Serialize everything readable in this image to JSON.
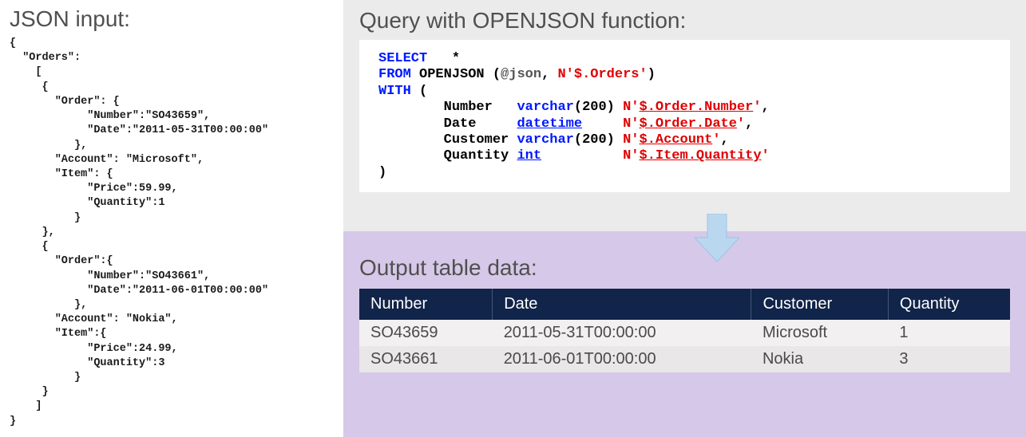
{
  "left": {
    "title": "JSON input:",
    "json_text": "{\n  \"Orders\":\n    [\n     {\n       \"Order\": {\n            \"Number\":\"SO43659\",\n            \"Date\":\"2011-05-31T00:00:00\"\n          },\n       \"Account\": \"Microsoft\",\n       \"Item\": {\n            \"Price\":59.99,\n            \"Quantity\":1\n          }\n     },\n     {\n       \"Order\":{\n            \"Number\":\"SO43661\",\n            \"Date\":\"2011-06-01T00:00:00\"\n          },\n       \"Account\": \"Nokia\",\n       \"Item\":{\n            \"Price\":24.99,\n            \"Quantity\":3\n          }\n     }\n    ]\n}"
  },
  "query": {
    "title": "Query with OPENJSON function:",
    "kw_select": "SELECT",
    "star": "*",
    "kw_from": "FROM",
    "fn_openjson": "OPENJSON",
    "paren_open": "(",
    "paren_close": ")",
    "var_json": "@json",
    "comma": ",",
    "orders_path": "N'$.Orders'",
    "kw_with": "WITH",
    "col1_name": "Number",
    "col1_type": "varchar",
    "col1_size": "(200)",
    "col1_path_prefix": "N'",
    "col1_path": "$.Order.Number",
    "col1_path_suffix": "'",
    "col2_name": "Date",
    "col2_type": "datetime",
    "col2_path_prefix": "N'",
    "col2_path": "$.Order.Date",
    "col2_path_suffix": "'",
    "col3_name": "Customer",
    "col3_type": "varchar",
    "col3_size": "(200)",
    "col3_path_prefix": "N'",
    "col3_path": "$.Account",
    "col3_path_suffix": "'",
    "col4_name": "Quantity",
    "col4_type": "int",
    "col4_path_prefix": "N'",
    "col4_path": "$.Item.Quantity",
    "col4_path_suffix": "'"
  },
  "output": {
    "title": "Output table data:",
    "headers": {
      "c1": "Number",
      "c2": "Date",
      "c3": "Customer",
      "c4": "Quantity"
    },
    "rows": [
      {
        "c1": "SO43659",
        "c2": "2011-05-31T00:00:00",
        "c3": "Microsoft",
        "c4": "1"
      },
      {
        "c1": "SO43661",
        "c2": "2011-06-01T00:00:00",
        "c3": "Nokia",
        "c4": "3"
      }
    ]
  }
}
